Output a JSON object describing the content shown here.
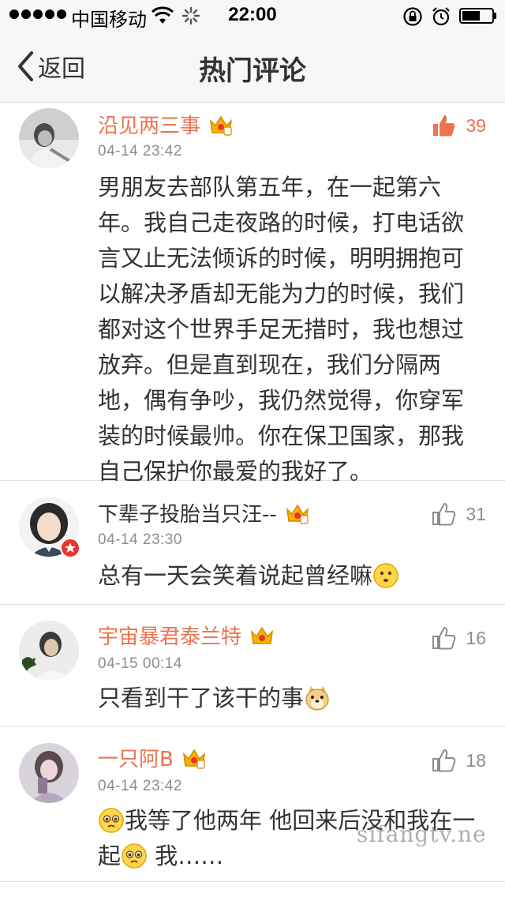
{
  "status_bar": {
    "carrier": "中国移动",
    "time": "22:00"
  },
  "nav": {
    "back_label": "返回",
    "title": "热门评论"
  },
  "comments": [
    {
      "username": "沿见两三事",
      "name_color": "orange",
      "timestamp": "04-14 23:42",
      "likes": "39",
      "liked": true,
      "text": "男朋友去部队第五年，在一起第六年。我自己走夜路的时候，打电话欲言又止无法倾诉的时候，明明拥抱可以解决矛盾却无能为力的时候，我们都对这个世界手足无措时，我也想过放弃。但是直到现在，我们分隔两地，偶有争吵，我仍然觉得，你穿军装的时候最帅。你在保卫国家，那我自己保护你最爱的我好了。"
    },
    {
      "username": "下辈子投胎当只汪--",
      "name_color": "dark",
      "timestamp": "04-14 23:30",
      "likes": "31",
      "liked": false,
      "text": "总有一天会笑着说起曾经嘛"
    },
    {
      "username": "宇宙暴君泰兰特",
      "name_color": "orange",
      "timestamp": "04-15 00:14",
      "likes": "16",
      "liked": false,
      "text": "只看到干了该干的事"
    },
    {
      "username": "一只阿B",
      "name_color": "orange",
      "timestamp": "04-14 23:42",
      "likes": "18",
      "liked": false,
      "text_part1": "我等了他两年 他回来后没和我在一起",
      "text_part2": " 我……"
    }
  ],
  "watermark": "sifangtv.ne",
  "icons": {
    "back": "chevron-left-icon",
    "like": "thumbs-up-icon",
    "vip": "crown-icon",
    "verified": "star-badge-icon"
  },
  "colors": {
    "accent": "#eb7350",
    "nav_bg": "#f7f7f7"
  }
}
